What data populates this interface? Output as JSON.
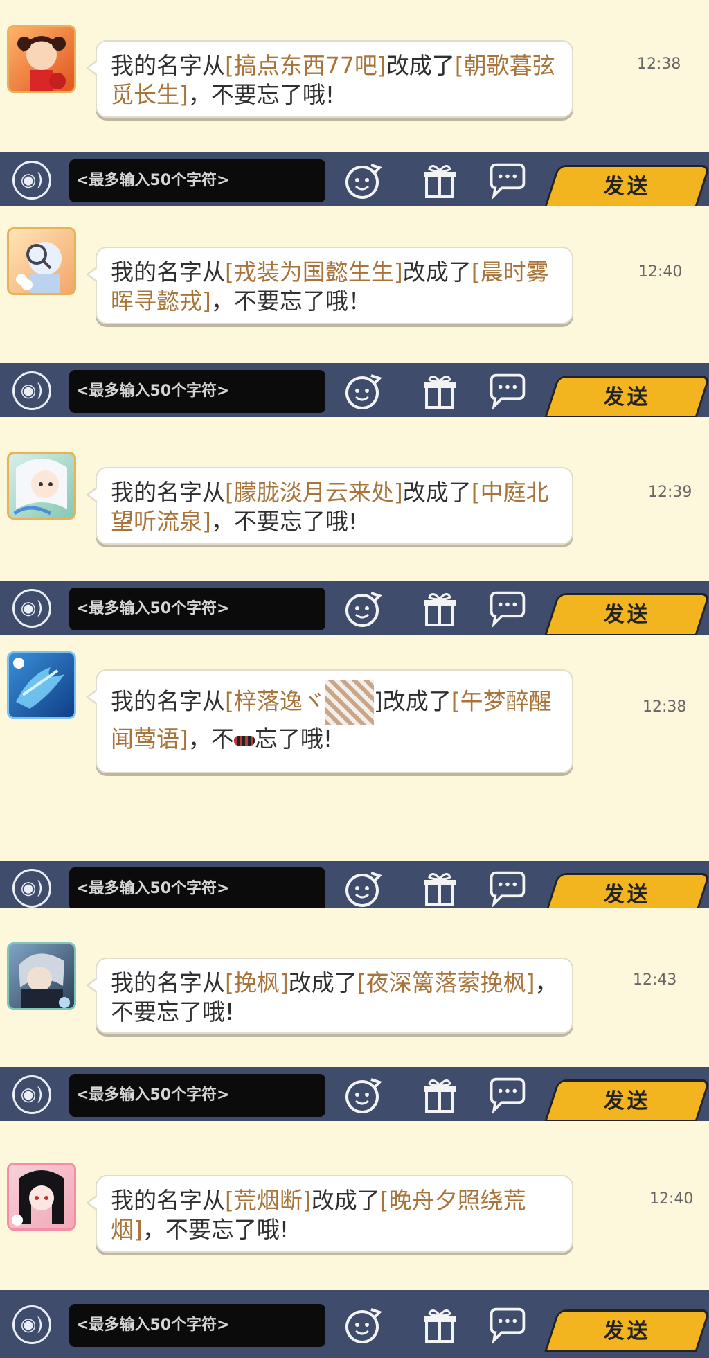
{
  "messages": [
    {
      "avatar": "avatar-girl-red",
      "prefix": "我的名字从",
      "old_name": "[搞点东西77吧]",
      "mid": "改成了",
      "new_name": "[朝歌暮弦觅长生]",
      "suffix": "，不要忘了哦!",
      "time": "12:38"
    },
    {
      "avatar": "avatar-magnifier-girl",
      "prefix": "我的名字从",
      "old_name": "[戎装为国懿生生]",
      "mid": "改成了",
      "new_name": "[晨时雾晖寻懿戎]",
      "suffix": "，不要忘了哦！",
      "time": "12:40"
    },
    {
      "avatar": "avatar-white-hair",
      "prefix": "我的名字从",
      "old_name": "[朦胧淡月云来处]",
      "mid": "改成了",
      "new_name": "[中庭北望听流泉]",
      "suffix": "，不要忘了哦!",
      "time": "12:39"
    },
    {
      "avatar": "avatar-blue-dragon",
      "prefix": "我的名字从",
      "old_name": "[梓落逸ヾ",
      "mid": "]改成了",
      "new_name": "[午梦醉醒闻莺语]",
      "suffix": "，不",
      "suffix2": "忘了哦!",
      "time": "12:38"
    },
    {
      "avatar": "avatar-dark-warrior",
      "prefix": "我的名字从",
      "old_name": "[挽枫]",
      "mid": "改成了",
      "new_name": "[夜深篱落萦挽枫]",
      "suffix": "，不要忘了哦!",
      "time": "12:43"
    },
    {
      "avatar": "avatar-black-hair-girl",
      "prefix": "我的名字从",
      "old_name": "[荒烟断]",
      "mid": "改成了",
      "new_name": "[晚舟夕照绕荒烟]",
      "suffix": "，不要忘了哦!",
      "time": "12:40"
    }
  ],
  "bar": {
    "placeholder": "<最多输入50个字符>",
    "send_label": "发送"
  },
  "colors": {
    "background": "#fdf7dc",
    "bar": "#3f4c6b",
    "highlight": "#a9743a",
    "send": "#f3b51f"
  }
}
